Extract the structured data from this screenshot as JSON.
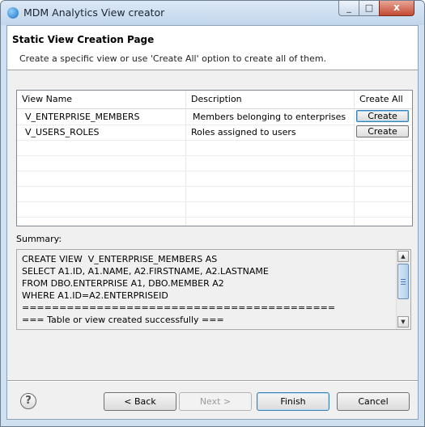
{
  "window": {
    "title": "MDM Analytics View creator",
    "close_glyph": "x",
    "max_glyph": "□",
    "min_glyph": "_"
  },
  "page": {
    "title": "Static View Creation Page",
    "description": "Create a specific view or use 'Create All' option to create all of them."
  },
  "table": {
    "columns": [
      "View Name",
      "Description",
      "Create All"
    ],
    "rows": [
      {
        "view_name": "V_ENTERPRISE_MEMBERS",
        "description": "Members belonging to enterprises",
        "button": "Create"
      },
      {
        "view_name": "V_USERS_ROLES",
        "description": "Roles assigned to users",
        "button": "Create"
      }
    ]
  },
  "summary": {
    "label": "Summary:",
    "lines": [
      "CREATE VIEW  V_ENTERPRISE_MEMBERS AS",
      "SELECT A1.ID, A1.NAME, A2.FIRSTNAME, A2.LASTNAME",
      "FROM DBO.ENTERPRISE A1, DBO.MEMBER A2",
      "WHERE A1.ID=A2.ENTERPRISEID",
      "==========================================",
      "=== Table or view created successfully ==="
    ]
  },
  "buttons": {
    "help": "?",
    "back": "< Back",
    "next": "Next >",
    "finish": "Finish",
    "cancel": "Cancel"
  },
  "icons": [
    "app-icon",
    "minimize-icon",
    "maximize-icon",
    "close-icon",
    "help-icon",
    "scroll-up-icon",
    "scroll-down-icon"
  ]
}
